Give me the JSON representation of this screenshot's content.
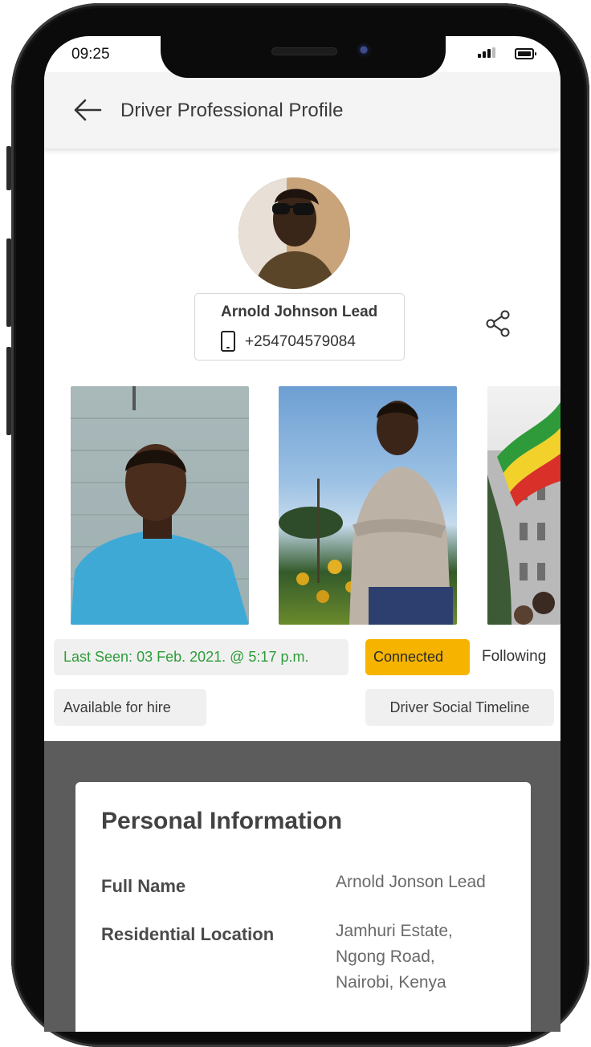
{
  "status_bar": {
    "time": "09:25"
  },
  "app_bar": {
    "title": "Driver Professional Profile",
    "back_icon": "arrow-left-icon"
  },
  "profile": {
    "name": "Arnold Johnson Lead",
    "phone": "+254704579084",
    "phone_icon": "mobile-phone-icon",
    "share_icon": "share-icon"
  },
  "status": {
    "last_seen": "Last Seen: 03 Feb. 2021. @ 5:17 p.m.",
    "connected": "Connected",
    "following": "Following",
    "available": "Available for hire",
    "timeline": "Driver Social Timeline"
  },
  "colors": {
    "connected_bg": "#f6b400",
    "last_seen_text": "#2e9d3a",
    "dark_band": "#5c5c5c"
  },
  "personal_info": {
    "title": "Personal Information",
    "full_name_label": "Full Name",
    "full_name_value": "Arnold Jonson Lead",
    "location_label": "Residential Location",
    "location_line1": "Jamhuri Estate,",
    "location_line2": "Ngong Road,",
    "location_line3": "Nairobi, Kenya"
  }
}
